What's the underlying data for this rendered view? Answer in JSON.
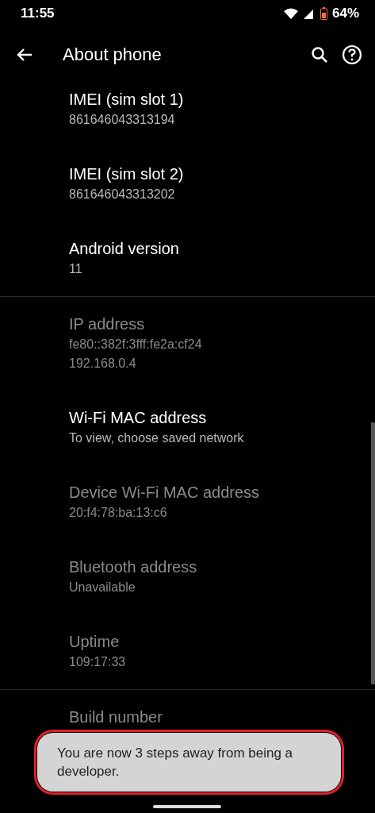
{
  "status_bar": {
    "time": "11:55",
    "battery": "64%"
  },
  "app_bar": {
    "title": "About phone"
  },
  "sections": [
    {
      "items": [
        {
          "title": "IMEI (sim slot 1)",
          "summary": [
            "861646043313194"
          ],
          "disabled": false
        },
        {
          "title": "IMEI (sim slot 2)",
          "summary": [
            "861646043313202"
          ],
          "disabled": false
        },
        {
          "title": "Android version",
          "summary": [
            "11"
          ],
          "disabled": false
        }
      ]
    },
    {
      "items": [
        {
          "title": "IP address",
          "summary": [
            "fe80::382f:3fff:fe2a:cf24",
            "192.168.0.4"
          ],
          "disabled": true
        },
        {
          "title": "Wi-Fi MAC address",
          "summary": [
            "To view, choose saved network"
          ],
          "disabled": false
        },
        {
          "title": "Device Wi-Fi MAC address",
          "summary": [
            "20:f4:78:ba:13:c6"
          ],
          "disabled": true
        },
        {
          "title": "Bluetooth address",
          "summary": [
            "Unavailable"
          ],
          "disabled": true
        },
        {
          "title": "Uptime",
          "summary": [
            "109:17:33"
          ],
          "disabled": true
        }
      ]
    },
    {
      "items": [
        {
          "title": "Build number",
          "disabled": true
        }
      ]
    }
  ],
  "toast": {
    "text": "You are now 3 steps away from being a developer.",
    "highlighted": true
  }
}
